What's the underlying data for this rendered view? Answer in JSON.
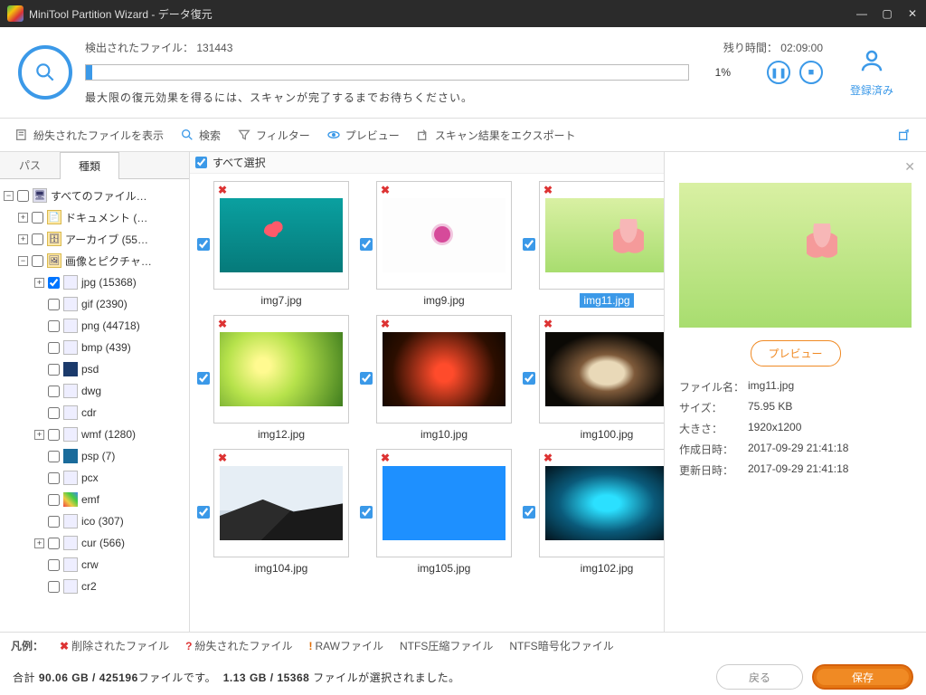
{
  "window": {
    "title": "MiniTool Partition Wizard - データ復元"
  },
  "status": {
    "found_label": "検出されたファイル：",
    "found_count": "131443",
    "remaining_label": "残り時間：",
    "remaining_value": "02:09:00",
    "progress_pct": "1%",
    "note": "最大限の復元効果を得るには、スキャンが完了するまでお待ちください。"
  },
  "account": {
    "label": "登録済み"
  },
  "toolbar": {
    "lost": "紛失されたファイルを表示",
    "search": "検索",
    "filter": "フィルター",
    "preview": "プレビュー",
    "export": "スキャン結果をエクスポート"
  },
  "tabs": {
    "path": "パス",
    "type": "種類"
  },
  "tree": {
    "root": "すべてのファイル…",
    "doc": "ドキュメント (…",
    "archive": "アーカイブ (55…",
    "images": "画像とピクチャ…",
    "items": [
      {
        "label": "jpg (15368)",
        "checked": true
      },
      {
        "label": "gif (2390)"
      },
      {
        "label": "png (44718)"
      },
      {
        "label": "bmp (439)"
      },
      {
        "label": "psd"
      },
      {
        "label": "dwg"
      },
      {
        "label": "cdr"
      },
      {
        "label": "wmf (1280)"
      },
      {
        "label": "psp (7)"
      },
      {
        "label": "pcx"
      },
      {
        "label": "emf"
      },
      {
        "label": "ico (307)"
      },
      {
        "label": "cur (566)"
      },
      {
        "label": "crw"
      },
      {
        "label": "cr2"
      }
    ]
  },
  "grid": {
    "select_all": "すべて選択",
    "items": [
      {
        "name": "img7.jpg",
        "style": "im-teal"
      },
      {
        "name": "img9.jpg",
        "style": "im-pink"
      },
      {
        "name": "img11.jpg",
        "style": "im-flower",
        "selected": true
      },
      {
        "name": "img12.jpg",
        "style": "im-green"
      },
      {
        "name": "img10.jpg",
        "style": "im-tulip"
      },
      {
        "name": "img100.jpg",
        "style": "im-cave"
      },
      {
        "name": "img104.jpg",
        "style": "im-mtn"
      },
      {
        "name": "img105.jpg",
        "style": "im-blue"
      },
      {
        "name": "img102.jpg",
        "style": "im-ice"
      }
    ]
  },
  "preview": {
    "btn": "プレビュー",
    "filename_k": "ファイル名：",
    "filename_v": "img11.jpg",
    "size_k": "サイズ：",
    "size_v": "75.95 KB",
    "dim_k": "大きさ：",
    "dim_v": "1920x1200",
    "created_k": "作成日時：",
    "created_v": "2017-09-29 21:41:18",
    "updated_k": "更新日時：",
    "updated_v": "2017-09-29 21:41:18"
  },
  "legend": {
    "title": "凡例：",
    "deleted": "削除されたファイル",
    "lost": "紛失されたファイル",
    "raw": "RAWファイル",
    "ntfs_comp": "NTFS圧縮ファイル",
    "ntfs_enc": "NTFS暗号化ファイル"
  },
  "footer": {
    "summary_a": "合計 ",
    "summary_b": "90.06 GB / 425196",
    "summary_c": "ファイルです。",
    "summary_d": "1.13 GB / 15368",
    "summary_e": " ファイルが選択されました。",
    "back": "戻る",
    "save": "保存"
  }
}
